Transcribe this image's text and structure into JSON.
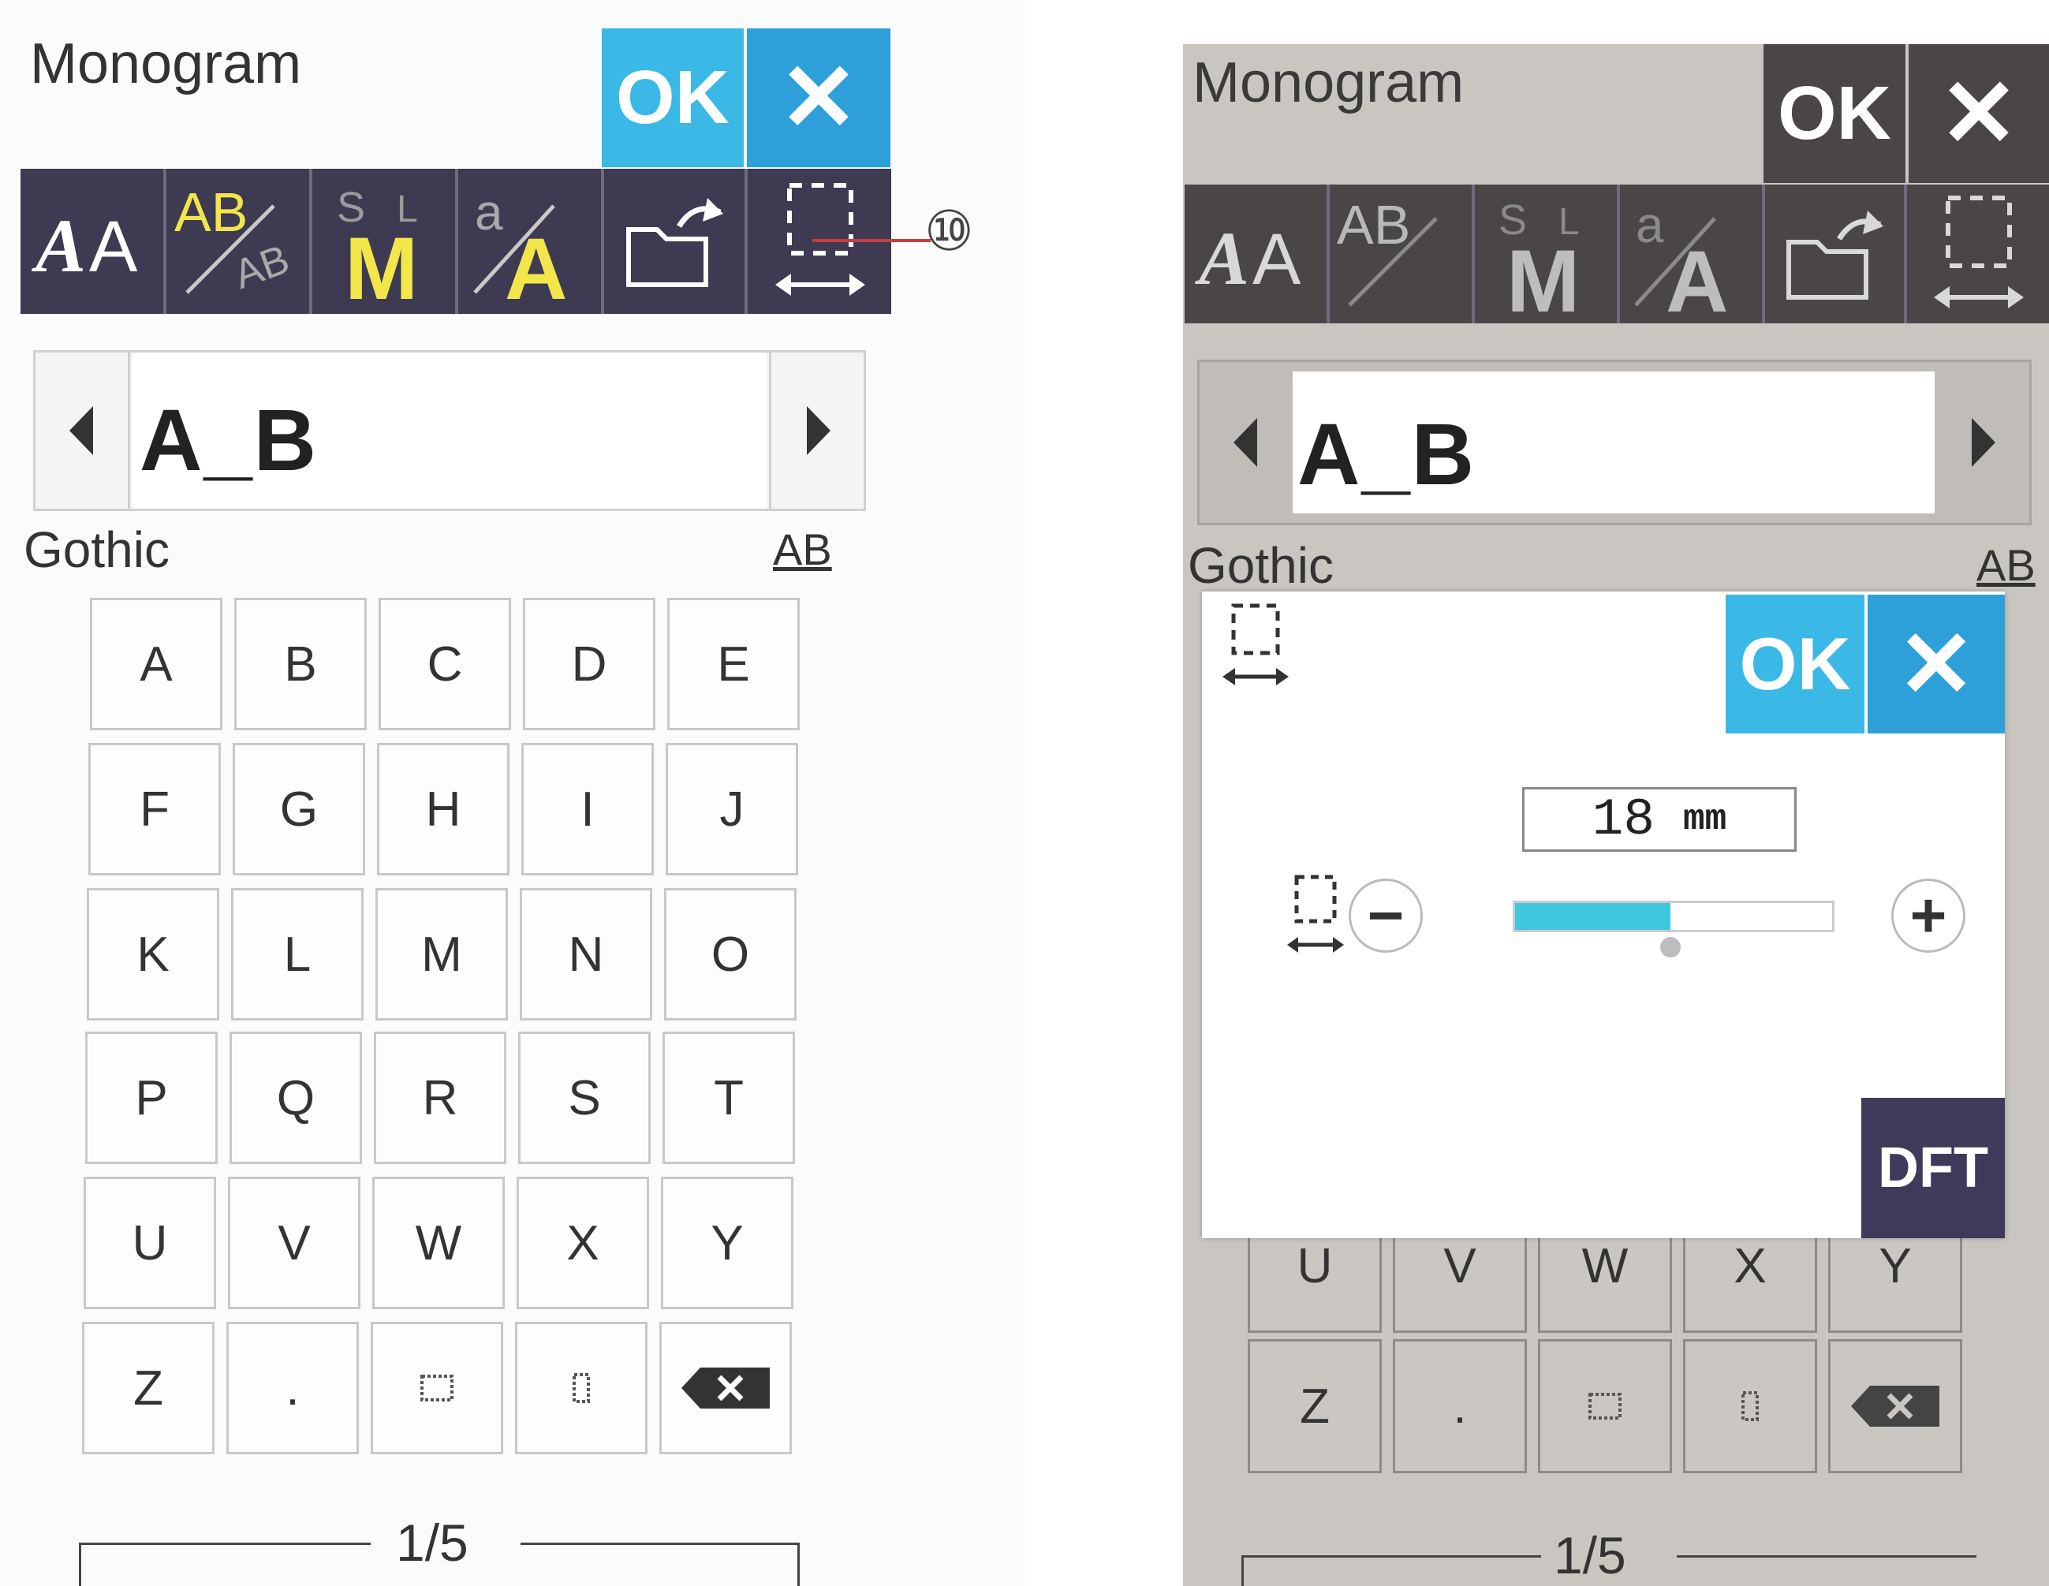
{
  "left_screen": {
    "title": "Monogram",
    "ok_label": "OK",
    "cancel_label": "✕",
    "toolbar": [
      "font-style-icon",
      "letter-case-icon",
      "monogram-size-icon",
      "lowercase-uppercase-icon",
      "open-file-icon",
      "spacing-icon"
    ],
    "entry_text": "A_B",
    "font_name": "Gothic",
    "ab_label": "AB",
    "keys": [
      [
        "A",
        "B",
        "C",
        "D",
        "E"
      ],
      [
        "F",
        "G",
        "H",
        "I",
        "J"
      ],
      [
        "K",
        "L",
        "M",
        "N",
        "O"
      ],
      [
        "P",
        "Q",
        "R",
        "S",
        "T"
      ],
      [
        "U",
        "V",
        "W",
        "X",
        "Y"
      ],
      [
        "Z",
        ".",
        "",
        "",
        ""
      ]
    ],
    "page_indicator": "1/5",
    "callout_number": "⑩"
  },
  "right_screen": {
    "title": "Monogram",
    "ok_label": "OK",
    "cancel_label": "✕",
    "entry_text": "A_B",
    "font_name": "Gothic",
    "ab_label": "AB",
    "dialog": {
      "ok_label": "OK",
      "cancel_label": "✕",
      "value_text": "18",
      "unit_text": "mm",
      "slider_fill": 0.49,
      "minus_label": "−",
      "plus_label": "+",
      "default_label": "DFT"
    },
    "visible_keys": [
      [
        "U",
        "V",
        "W",
        "X",
        "Y"
      ],
      [
        "Z",
        ".",
        "",
        "",
        ""
      ]
    ],
    "page_indicator": "1/5"
  },
  "colors": {
    "ok_blue": "#3ab8e6",
    "ok_blue_dark": "#2da0da",
    "toolbar_bg": "#3d3a52",
    "yellow": "#f2e64a",
    "slider_cyan": "#3fc7e0",
    "dft_bg": "#3e3a5a"
  }
}
